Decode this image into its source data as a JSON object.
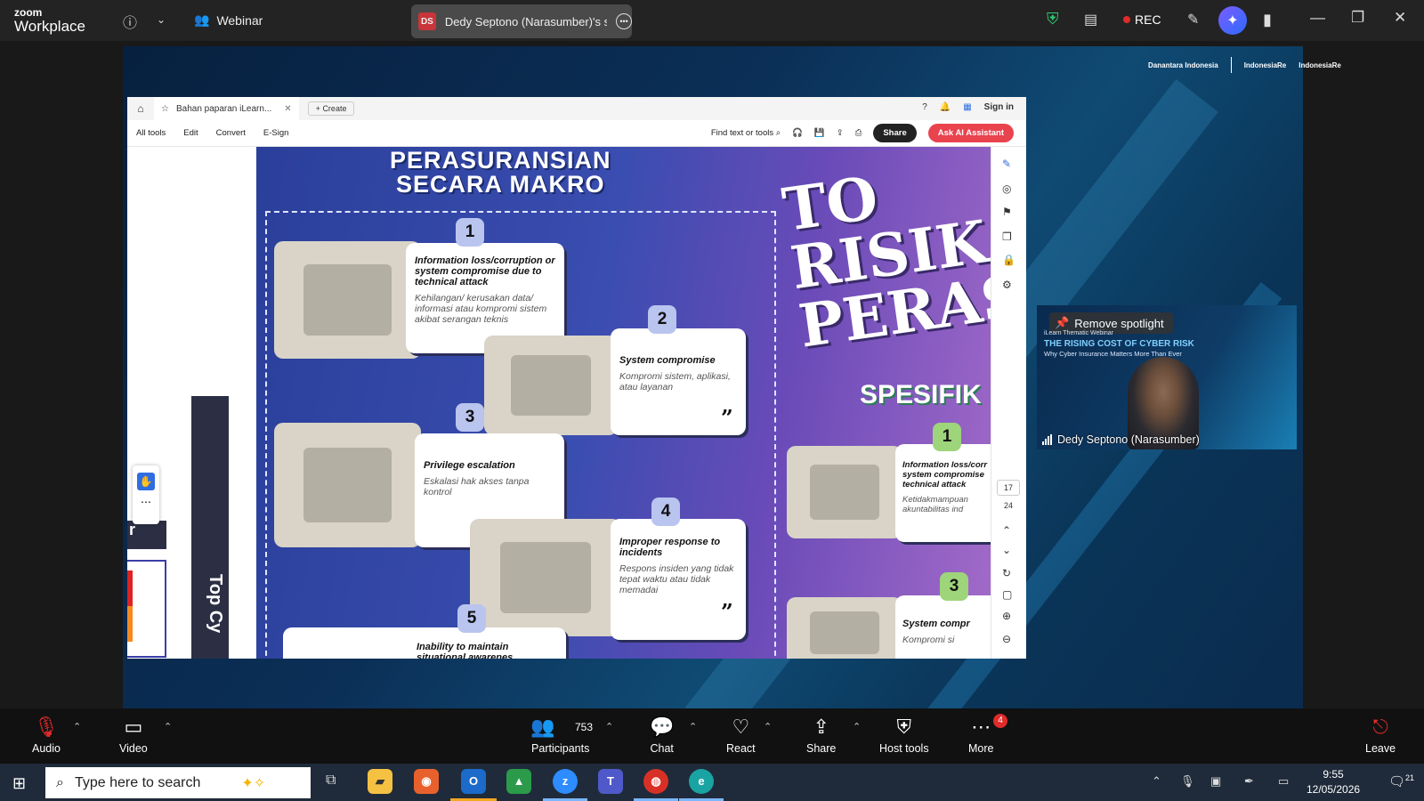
{
  "titlebar": {
    "logo_top": "zoom",
    "logo_bottom": "Workplace",
    "webinar_label": "Webinar",
    "share_initials": "DS",
    "share_title": "Dedy Septono (Narasumber)'s scr",
    "rec_label": "REC"
  },
  "slide_brand": {
    "brand_a": "Danantara Indonesia",
    "brand_b": "IndonesiaRe",
    "brand_c": "IndonesiaRe"
  },
  "browser": {
    "tab_title": "Bahan paparan iLearn...",
    "create_label": "Create",
    "sign_in": "Sign in",
    "menu": [
      "All tools",
      "Edit",
      "Convert",
      "E-Sign"
    ],
    "find_label": "Find text or tools",
    "share_btn": "Share",
    "ai_btn": "Ask AI Assistant",
    "page_numbers": [
      "17",
      "24"
    ]
  },
  "document": {
    "title_line1": "PERASURANSIAN",
    "title_line2": "SECARA MAKRO",
    "big_title": [
      "TO",
      "RISIK",
      "PERAS"
    ],
    "spesifik": "SPESIFIK",
    "left_label": "Top Cy",
    "left_char": "r",
    "items": [
      {
        "num": "1",
        "title": "Information loss/corruption or system compromise due to technical attack",
        "desc": "Kehilangan/ kerusakan data/ informasi atau kompromi sistem akibat serangan teknis"
      },
      {
        "num": "2",
        "title": "System compromise",
        "desc": "Kompromi sistem, aplikasi, atau layanan"
      },
      {
        "num": "3",
        "title": "Privilege escalation",
        "desc": "Eskalasi hak akses tanpa kontrol"
      },
      {
        "num": "4",
        "title": "Improper response to incidents",
        "desc": "Respons insiden yang tidak tepat waktu atau tidak memadai"
      },
      {
        "num": "5",
        "title": "Inability to maintain situational awarenes",
        "desc": ""
      }
    ],
    "right_items": [
      {
        "num": "1",
        "title": "Information loss/corr system compromise technical attack",
        "desc": "Ketidakmampuan akuntabilitas ind"
      },
      {
        "num": "3",
        "title": "System compr",
        "desc": "Kompromi si"
      }
    ]
  },
  "speaker": {
    "remove_spotlight": "Remove spotlight",
    "slide_kicker": "iLearn Thematic Webinar",
    "slide_title": "THE RISING COST OF CYBER RISK",
    "slide_sub": "Why Cyber Insurance Matters More Than Ever",
    "name": "Dedy Septono (Narasumber)"
  },
  "toolbar": {
    "audio": "Audio",
    "video": "Video",
    "participants": "Participants",
    "participants_count": "753",
    "chat": "Chat",
    "react": "React",
    "share": "Share",
    "host_tools": "Host tools",
    "more": "More",
    "more_badge": "4",
    "leave": "Leave"
  },
  "taskbar": {
    "search_placeholder": "Type here to search",
    "time": "9:55",
    "date": "12/05/2026",
    "notif_count": "21"
  },
  "colors": {
    "rec_dot": "#e02b2b",
    "ai_button": "#e9434e",
    "shield": "#2ecc71"
  }
}
